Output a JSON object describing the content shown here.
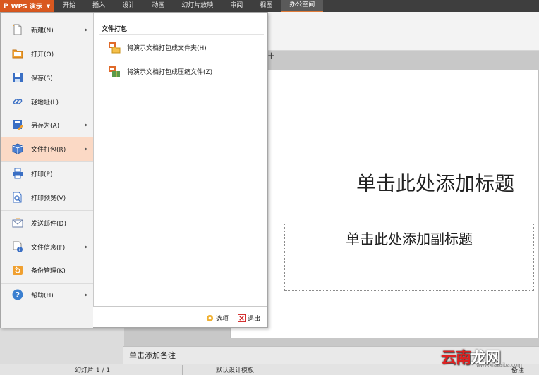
{
  "app": {
    "title": "WPS 演示",
    "logo": "P"
  },
  "tabs": [
    "开始",
    "插入",
    "设计",
    "动画",
    "幻灯片放映",
    "审阅",
    "视图",
    "办公空间"
  ],
  "active_tab": "办公空间",
  "menu": {
    "items": [
      {
        "label": "新建(N)",
        "icon": "new-document-icon",
        "arrow": true
      },
      {
        "label": "打开(O)",
        "icon": "folder-open-icon",
        "arrow": false
      },
      {
        "label": "保存(S)",
        "icon": "save-icon",
        "arrow": false
      },
      {
        "label": "轻地址(L)",
        "icon": "link-icon",
        "arrow": false
      },
      {
        "label": "另存为(A)",
        "icon": "save-as-icon",
        "arrow": true
      },
      {
        "label": "文件打包(R)",
        "icon": "package-icon",
        "arrow": true
      },
      {
        "label": "打印(P)",
        "icon": "print-icon",
        "arrow": false
      },
      {
        "label": "打印预览(V)",
        "icon": "print-preview-icon",
        "arrow": false
      },
      {
        "label": "发送邮件(D)",
        "icon": "mail-icon",
        "arrow": false
      },
      {
        "label": "文件信息(F)",
        "icon": "file-info-icon",
        "arrow": true
      },
      {
        "label": "备份管理(K)",
        "icon": "backup-icon",
        "arrow": false
      },
      {
        "label": "帮助(H)",
        "icon": "help-icon",
        "arrow": true
      }
    ],
    "active_item": "文件打包(R)"
  },
  "submenu": {
    "title": "文件打包",
    "items": [
      {
        "label": "将演示文档打包成文件夹(H)",
        "icon": "pack-folder-icon"
      },
      {
        "label": "将演示文档打包成压缩文件(Z)",
        "icon": "pack-zip-icon"
      }
    ]
  },
  "bottom_buttons": {
    "options": "选项",
    "exit": "退出"
  },
  "slide": {
    "title_placeholder": "单击此处添加标题",
    "subtitle_placeholder": "单击此处添加副标题"
  },
  "notes_placeholder": "单击添加备注",
  "status": {
    "slide": "幻灯片 1 / 1",
    "template": "默认设计模板",
    "notes": "备注"
  },
  "watermark": {
    "text_red": "云南",
    "text_rest": "龙网",
    "url": "www.xiazaiba.com"
  },
  "colors": {
    "accent": "#d9581f",
    "menu_active": "#fbd9c5",
    "menubar": "#3e3e3e"
  }
}
